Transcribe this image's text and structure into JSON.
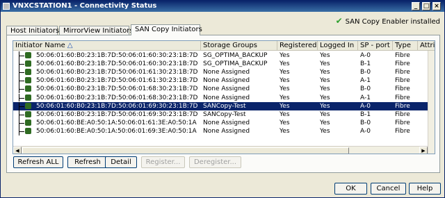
{
  "window": {
    "title": "VNXCSTATION1 - Connectivity Status",
    "min_glyph": "_",
    "max_glyph": "□",
    "close_glyph": "×"
  },
  "status": {
    "icon": "check-icon",
    "text": "SAN Copy Enabler installed",
    "color": "#2ea02e"
  },
  "tabs": [
    {
      "label": "Host Initiators",
      "active": false
    },
    {
      "label": "MirrorView Initiators",
      "active": false
    },
    {
      "label": "SAN Copy Initiators",
      "active": true
    }
  ],
  "table": {
    "columns": [
      "Initiator Name",
      "Storage Groups",
      "Registered",
      "Logged In",
      "SP - port",
      "Type",
      "Attrib"
    ],
    "sort_indicator": "△",
    "rows": [
      [
        "50:06:01:60:B0:23:1B:7D:50:06:01:60:30:23:1B:7D",
        "SG_OPTIMA_BACKUP",
        "Yes",
        "Yes",
        "A-0",
        "Fibre"
      ],
      [
        "50:06:01:60:B0:23:1B:7D:50:06:01:60:30:23:1B:7D",
        "SG_OPTIMA_BACKUP",
        "Yes",
        "Yes",
        "B-1",
        "Fibre"
      ],
      [
        "50:06:01:60:B0:23:1B:7D:50:06:01:61:30:23:1B:7D",
        "None Assigned",
        "Yes",
        "Yes",
        "B-0",
        "Fibre"
      ],
      [
        "50:06:01:60:B0:23:1B:7D:50:06:01:61:30:23:1B:7D",
        "None Assigned",
        "Yes",
        "Yes",
        "A-1",
        "Fibre"
      ],
      [
        "50:06:01:60:B0:23:1B:7D:50:06:01:68:30:23:1B:7D",
        "None Assigned",
        "Yes",
        "Yes",
        "B-0",
        "Fibre"
      ],
      [
        "50:06:01:60:B0:23:1B:7D:50:06:01:68:30:23:1B:7D",
        "None Assigned",
        "Yes",
        "Yes",
        "A-1",
        "Fibre"
      ],
      [
        "50:06:01:60:B0:23:1B:7D:50:06:01:69:30:23:1B:7D",
        "SANCopy-Test",
        "Yes",
        "Yes",
        "A-0",
        "Fibre"
      ],
      [
        "50:06:01:60:B0:23:1B:7D:50:06:01:69:30:23:1B:7D",
        "SANCopy-Test",
        "Yes",
        "Yes",
        "B-1",
        "Fibre"
      ],
      [
        "50:06:01:60:BE:A0:50:1A:50:06:01:61:3E:A0:50:1A",
        "None Assigned",
        "Yes",
        "Yes",
        "B-0",
        "Fibre"
      ],
      [
        "50:06:01:60:BE:A0:50:1A:50:06:01:69:3E:A0:50:1A",
        "None Assigned",
        "Yes",
        "Yes",
        "A-0",
        "Fibre"
      ]
    ],
    "selected_row": 6,
    "scroll_left_glyph": "◀",
    "scroll_right_glyph": "▶"
  },
  "actions": {
    "refresh_all": "Refresh ALL",
    "refresh": "Refresh",
    "detail": "Detail",
    "register": "Register...",
    "deregister": "Deregister..."
  },
  "footer": {
    "ok": "OK",
    "cancel": "Cancel",
    "help": "Help"
  },
  "colors": {
    "selection": "#0a246a",
    "titlebar": "#0a246a",
    "tree_node": "#2f6b22"
  }
}
